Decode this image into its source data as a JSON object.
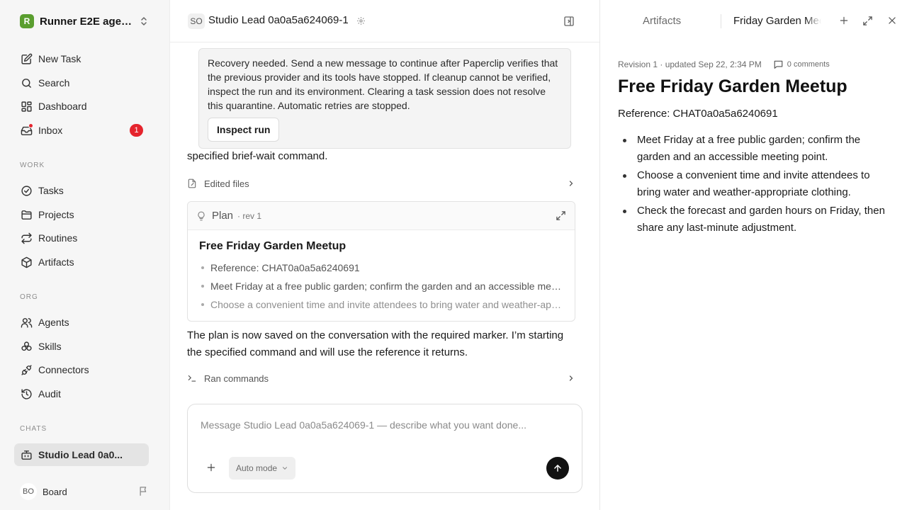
{
  "workspace": {
    "logo": "R",
    "name": "Runner E2E agen..."
  },
  "nav_main": [
    {
      "label": "New Task",
      "icon": "edit-icon"
    },
    {
      "label": "Search",
      "icon": "search-icon"
    },
    {
      "label": "Dashboard",
      "icon": "dashboard-icon"
    },
    {
      "label": "Inbox",
      "icon": "inbox-icon",
      "badge": "1"
    }
  ],
  "sections": {
    "work": "WORK",
    "org": "ORG",
    "chats": "CHATS"
  },
  "nav_work": [
    {
      "label": "Tasks",
      "icon": "check-circle-icon"
    },
    {
      "label": "Projects",
      "icon": "folder-icon"
    },
    {
      "label": "Routines",
      "icon": "repeat-icon"
    },
    {
      "label": "Artifacts",
      "icon": "box-icon"
    }
  ],
  "nav_org": [
    {
      "label": "Agents",
      "icon": "users-icon"
    },
    {
      "label": "Skills",
      "icon": "skills-icon"
    },
    {
      "label": "Connectors",
      "icon": "plug-icon"
    },
    {
      "label": "Audit",
      "icon": "history-icon"
    }
  ],
  "chats": [
    {
      "label": "Studio Lead 0a0...",
      "icon": "bot-icon",
      "active": true
    }
  ],
  "user": {
    "initials": "BO",
    "name": "Board"
  },
  "chat": {
    "agent_initials": "SO",
    "title": "Studio Lead 0a0a5a624069-1",
    "notice": {
      "text": "Recovery needed. Send a new message to continue after Paperclip verifies that the previous provider and its tools have stopped. If cleanup cannot be verified, inspect the run and its environment. Clearing a task session does not resolve this quarantine. Automatic retries are stopped.",
      "button": "Inspect run"
    },
    "cut_text": "specified brief-wait command.",
    "edited_files": "Edited files",
    "plan": {
      "label": "Plan",
      "rev": "· rev 1",
      "title": "Free Friday Garden Meetup",
      "items": [
        "Reference: CHAT0a0a5a6240691",
        "Meet Friday at a free public garden; confirm the garden and an accessible meeting point.",
        "Choose a convenient time and invite attendees to bring water and weather-appropriate clothing."
      ]
    },
    "message": "The plan is now saved on the conversation with the required marker. I’m starting the specified command and will use the reference it returns.",
    "ran_commands": "Ran commands",
    "composer": {
      "placeholder": "Message Studio Lead 0a0a5a624069-1 — describe what you want done...",
      "mode": "Auto mode"
    }
  },
  "panel": {
    "tab_artifacts": "Artifacts",
    "tab_active": "Friday Garden Meetup",
    "meta": "Revision 1 · updated Sep 22, 2:34 PM",
    "comments": "0 comments",
    "title": "Free Friday Garden Meetup",
    "reference": "Reference: CHAT0a0a5a6240691",
    "items": [
      "Meet Friday at a free public garden; confirm the garden and an accessible meeting point.",
      "Choose a convenient time and invite attendees to bring water and weather-appropriate clothing.",
      "Check the forecast and garden hours on Friday, then share any last-minute adjustment."
    ]
  },
  "colors": {
    "badge": "#e5242d",
    "logo": "#5a9e2f",
    "send": "#111111"
  }
}
